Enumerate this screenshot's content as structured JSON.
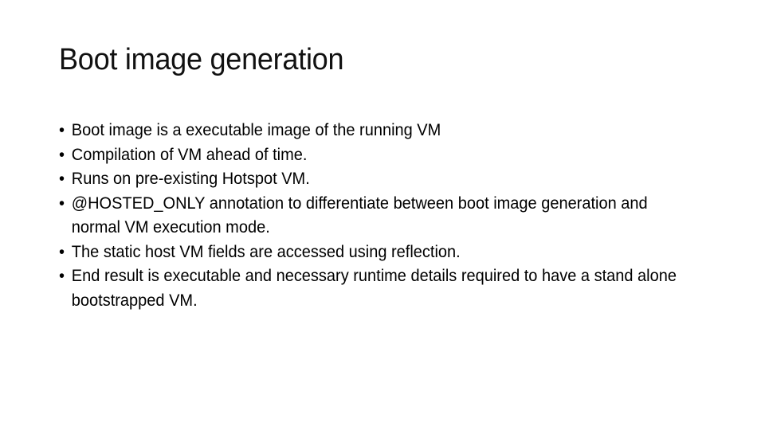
{
  "slide": {
    "title": "Boot image generation",
    "bullet_glyph": "•",
    "bullets": [
      "Boot image is a executable image of the running VM",
      "Compilation of VM ahead of time.",
      "Runs on pre-existing Hotspot VM.",
      "@HOSTED_ONLY annotation to differentiate between boot image generation and normal VM execution mode.",
      "The static host VM fields are accessed using reflection.",
      "End result is executable and necessary runtime details required to have a stand alone bootstrapped VM."
    ]
  }
}
